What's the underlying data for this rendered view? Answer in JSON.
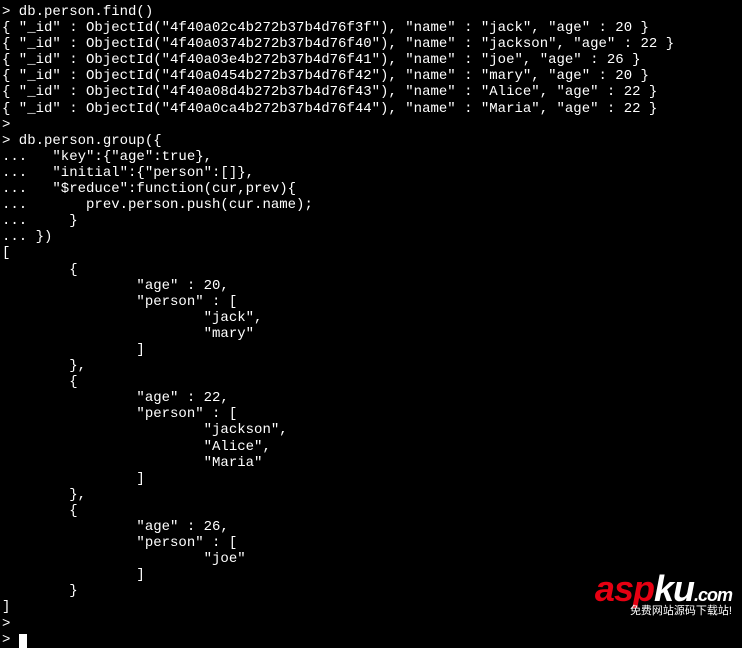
{
  "lines": [
    "> db.person.find()",
    "{ \"_id\" : ObjectId(\"4f40a02c4b272b37b4d76f3f\"), \"name\" : \"jack\", \"age\" : 20 }",
    "{ \"_id\" : ObjectId(\"4f40a0374b272b37b4d76f40\"), \"name\" : \"jackson\", \"age\" : 22 }",
    "{ \"_id\" : ObjectId(\"4f40a03e4b272b37b4d76f41\"), \"name\" : \"joe\", \"age\" : 26 }",
    "{ \"_id\" : ObjectId(\"4f40a0454b272b37b4d76f42\"), \"name\" : \"mary\", \"age\" : 20 }",
    "{ \"_id\" : ObjectId(\"4f40a08d4b272b37b4d76f43\"), \"name\" : \"Alice\", \"age\" : 22 }",
    "{ \"_id\" : ObjectId(\"4f40a0ca4b272b37b4d76f44\"), \"name\" : \"Maria\", \"age\" : 22 }",
    ">",
    "> db.person.group({",
    "...   \"key\":{\"age\":true},",
    "...   \"initial\":{\"person\":[]},",
    "...   \"$reduce\":function(cur,prev){",
    "...       prev.person.push(cur.name);",
    "...     }",
    "... })",
    "[",
    "        {",
    "                \"age\" : 20,",
    "                \"person\" : [",
    "                        \"jack\",",
    "                        \"mary\"",
    "                ]",
    "        },",
    "        {",
    "                \"age\" : 22,",
    "                \"person\" : [",
    "                        \"jackson\",",
    "                        \"Alice\",",
    "                        \"Maria\"",
    "                ]",
    "        },",
    "        {",
    "                \"age\" : 26,",
    "                \"person\" : [",
    "                        \"joe\"",
    "                ]",
    "        }",
    "]",
    ">"
  ],
  "watermark": {
    "red_part": "asp",
    "white_part": "ku",
    "dotcom": ".com",
    "sub": "免费网站源码下载站!"
  },
  "chart_data": {
    "type": "table",
    "find_results": [
      {
        "_id": "4f40a02c4b272b37b4d76f3f",
        "name": "jack",
        "age": 20
      },
      {
        "_id": "4f40a0374b272b37b4d76f40",
        "name": "jackson",
        "age": 22
      },
      {
        "_id": "4f40a03e4b272b37b4d76f41",
        "name": "joe",
        "age": 26
      },
      {
        "_id": "4f40a0454b272b37b4d76f42",
        "name": "mary",
        "age": 20
      },
      {
        "_id": "4f40a08d4b272b37b4d76f43",
        "name": "Alice",
        "age": 22
      },
      {
        "_id": "4f40a0ca4b272b37b4d76f44",
        "name": "Maria",
        "age": 22
      }
    ],
    "group_query": {
      "key": {
        "age": true
      },
      "initial": {
        "person": []
      },
      "reduce": "function(cur,prev){ prev.person.push(cur.name); }"
    },
    "group_result": [
      {
        "age": 20,
        "person": [
          "jack",
          "mary"
        ]
      },
      {
        "age": 22,
        "person": [
          "jackson",
          "Alice",
          "Maria"
        ]
      },
      {
        "age": 26,
        "person": [
          "joe"
        ]
      }
    ]
  }
}
